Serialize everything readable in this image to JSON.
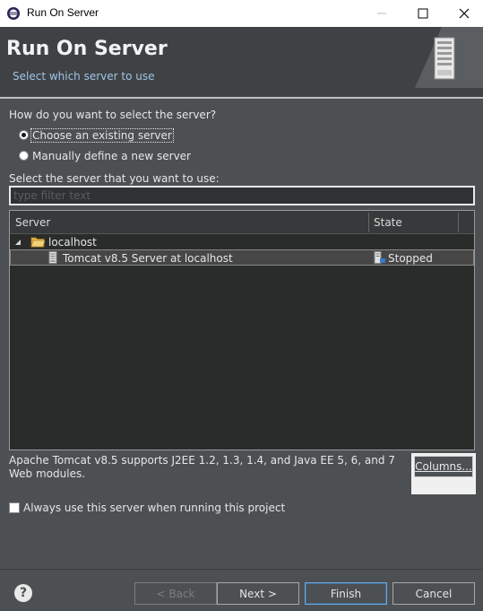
{
  "window": {
    "title": "Run On Server",
    "minimize_icon": "minimize-icon",
    "maximize_icon": "maximize-icon",
    "close_icon": "close-icon"
  },
  "banner": {
    "title": "Run On Server",
    "subtitle": "Select which server to use",
    "art_icon": "server-rack-icon"
  },
  "selection": {
    "question": "How do you want to select the server?",
    "options": [
      {
        "label": "Choose an existing server",
        "checked": true
      },
      {
        "label": "Manually define a new server",
        "checked": false
      }
    ]
  },
  "server_list": {
    "label": "Select the server that you want to use:",
    "filter_placeholder": "type filter text",
    "columns": [
      "Server",
      "State"
    ],
    "rows": [
      {
        "name": "localhost",
        "state": "",
        "icon": "folder-icon",
        "expanded": true
      },
      {
        "name": "Tomcat v8.5 Server at localhost",
        "state": "Stopped",
        "icon": "server-icon",
        "selected": true
      }
    ]
  },
  "description": "Apache Tomcat v8.5 supports J2EE 1.2, 1.3, 1.4, and Java EE 5, 6, and 7 Web modules.",
  "columns_button": "Columns...",
  "always_use": {
    "label": "Always use this server when running this project",
    "checked": false
  },
  "footer": {
    "help_icon": "help-icon",
    "back": "< Back",
    "next": "Next >",
    "finish": "Finish",
    "cancel": "Cancel"
  },
  "colors": {
    "background": "#4c5052",
    "banner": "#3f4244",
    "subtitle": "#9fc4e8",
    "table": "#2a2b2b"
  }
}
